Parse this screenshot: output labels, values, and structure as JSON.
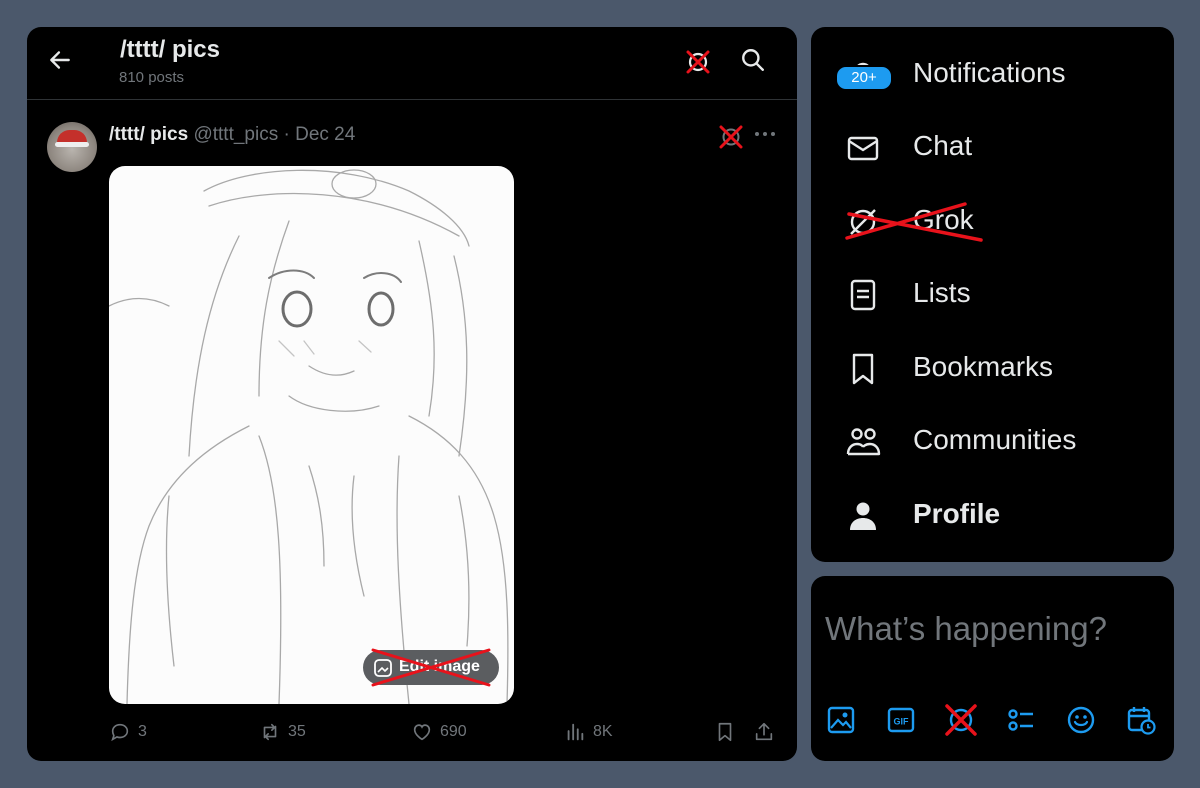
{
  "header": {
    "title": "/tttt/ pics",
    "post_count": "810 posts"
  },
  "post": {
    "author_name": "/tttt/ pics",
    "handle": "@tttt_pics",
    "separator": "·",
    "date": "Dec 24",
    "edit_image_label": "Edit image",
    "stats": {
      "replies": "3",
      "reposts": "35",
      "likes": "690",
      "views": "8K"
    }
  },
  "nav": {
    "notifications_badge": "20+",
    "items": [
      {
        "label": "Notifications",
        "icon": "bell-icon"
      },
      {
        "label": "Chat",
        "icon": "envelope-icon"
      },
      {
        "label": "Grok",
        "icon": "grok-icon"
      },
      {
        "label": "Lists",
        "icon": "list-icon"
      },
      {
        "label": "Bookmarks",
        "icon": "bookmark-icon"
      },
      {
        "label": "Communities",
        "icon": "communities-icon"
      },
      {
        "label": "Profile",
        "icon": "person-icon"
      }
    ]
  },
  "compose": {
    "placeholder": "What’s happening?",
    "tools": [
      "image-icon",
      "gif-icon",
      "grok-icon",
      "poll-icon",
      "emoji-icon",
      "schedule-icon"
    ]
  },
  "colors": {
    "accent": "#1d9bf0",
    "background": "#000000",
    "frame": "#4b586b",
    "muted_text": "#71767b",
    "strike_red": "#e8121b"
  }
}
